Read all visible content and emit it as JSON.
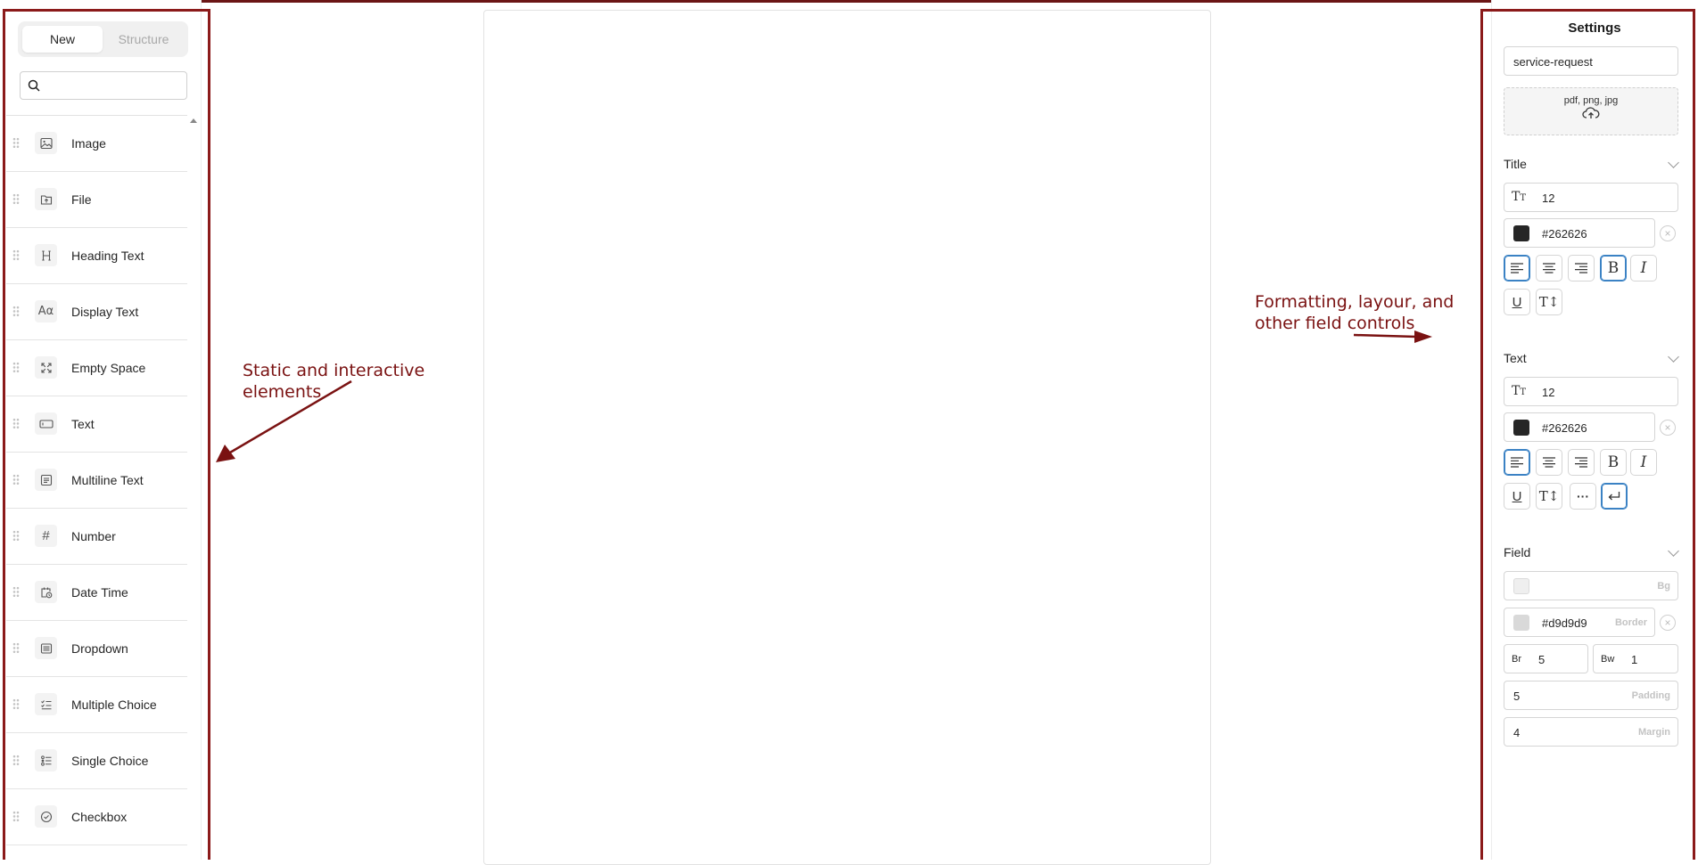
{
  "left_panel": {
    "tabs": {
      "new": "New",
      "structure": "Structure"
    },
    "search": {
      "value": "",
      "placeholder": ""
    },
    "elements": [
      {
        "label": "Image",
        "icon": "image-icon"
      },
      {
        "label": "File",
        "icon": "file-upload-icon"
      },
      {
        "label": "Heading Text",
        "icon": "heading-icon"
      },
      {
        "label": "Display Text",
        "icon": "display-text-icon"
      },
      {
        "label": "Empty Space",
        "icon": "expand-icon"
      },
      {
        "label": "Text",
        "icon": "text-field-icon"
      },
      {
        "label": "Multiline Text",
        "icon": "multiline-text-icon"
      },
      {
        "label": "Number",
        "icon": "hash-icon"
      },
      {
        "label": "Date Time",
        "icon": "calendar-clock-icon"
      },
      {
        "label": "Dropdown",
        "icon": "dropdown-icon"
      },
      {
        "label": "Multiple Choice",
        "icon": "checklist-icon"
      },
      {
        "label": "Single Choice",
        "icon": "radio-list-icon"
      },
      {
        "label": "Checkbox",
        "icon": "check-circle-icon"
      }
    ]
  },
  "annotations": {
    "left_line1": "Static and interactive",
    "left_line2": "elements",
    "right_line1": "Formatting, layour, and",
    "right_line2": "other field controls",
    "color": "#7a1212"
  },
  "settings": {
    "title": "Settings",
    "form_name": "service-request",
    "upload_types": "pdf, png, jpg",
    "title_section": {
      "label": "Title",
      "font_size": "12",
      "color": "#262626"
    },
    "text_section": {
      "label": "Text",
      "font_size": "12",
      "color": "#262626"
    },
    "field_section": {
      "label": "Field",
      "bg_label": "Bg",
      "bg_value": "",
      "bg_color": "#efefef",
      "border_value": "#d9d9d9",
      "border_label": "Border",
      "br_label": "Br",
      "br_value": "5",
      "bw_label": "Bw",
      "bw_value": "1",
      "padding_value": "5",
      "padding_label": "Padding",
      "margin_value": "4",
      "margin_label": "Margin"
    }
  }
}
